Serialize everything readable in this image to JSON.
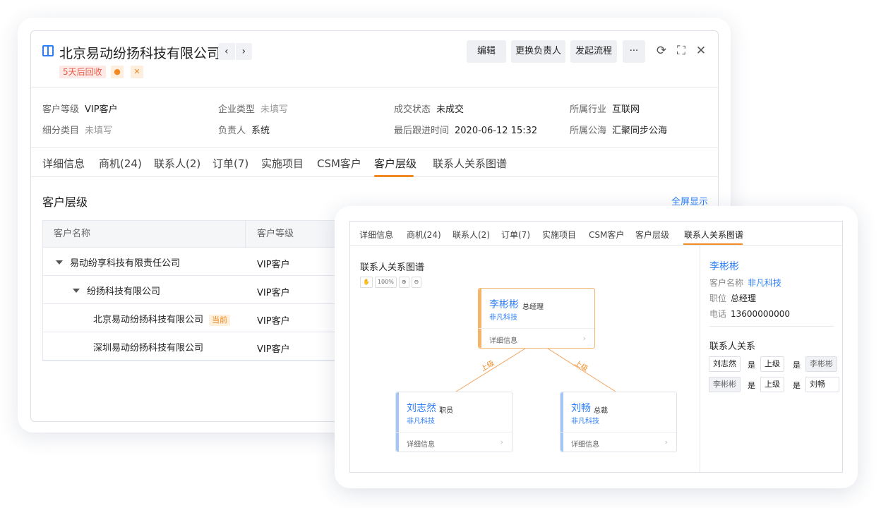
{
  "main": {
    "title": "北京易动纷扬科技有限公司",
    "prev_icon": "chevron-left-icon",
    "next_icon": "chevron-right-icon",
    "recycle_tag": "5天后回收",
    "actions": {
      "edit": "编辑",
      "change_owner": "更换负责人",
      "start_flow": "发起流程",
      "more": "···"
    },
    "info": [
      {
        "label": "客户等级",
        "value": "VIP客户"
      },
      {
        "label": "企业类型",
        "value": "未填写"
      },
      {
        "label": "成交状态",
        "value": "未成交"
      },
      {
        "label": "所属行业",
        "value": "互联网"
      },
      {
        "label": "细分类目",
        "value": "未填写"
      },
      {
        "label": "负责人",
        "value": "系统"
      },
      {
        "label": "最后跟进时间",
        "value": "2020-06-12 15:32"
      },
      {
        "label": "所属公海",
        "value": "汇聚同步公海"
      }
    ],
    "tabs": [
      "详细信息",
      "商机(24)",
      "联系人(2)",
      "订单(7)",
      "实施项目",
      "CSM客户",
      "客户层级",
      "联系人关系图谱"
    ],
    "section_title": "客户层级",
    "fullscreen_link": "全屏显示",
    "table": {
      "headers": [
        "客户名称",
        "客户等级"
      ],
      "rows": [
        {
          "name": "易动纷享科技有限责任公司",
          "level": "VIP客户"
        },
        {
          "name": "纷扬科技有限公司",
          "level": "VIP客户"
        },
        {
          "name": "北京易动纷扬科技有限公司",
          "level": "VIP客户",
          "tag": "当前"
        },
        {
          "name": "深圳易动纷扬科技有限公司",
          "level": "VIP客户"
        }
      ]
    }
  },
  "graph_panel": {
    "tabs": [
      "详细信息",
      "商机(24)",
      "联系人(2)",
      "订单(7)",
      "实施项目",
      "CSM客户",
      "客户层级",
      "联系人关系图谱"
    ],
    "title": "联系人关系图谱",
    "zoom": "100%",
    "edge_label": "上级",
    "nodes": {
      "root": {
        "name": "李彬彬",
        "role": "总经理",
        "company": "非凡科技",
        "detail": "详细信息"
      },
      "left": {
        "name": "刘志然",
        "role": "职员",
        "company": "非凡科技",
        "detail": "详细信息"
      },
      "right": {
        "name": "刘畅",
        "role": "总裁",
        "company": "非凡科技",
        "detail": "详细信息"
      }
    },
    "side": {
      "name": "李彬彬",
      "customer_label": "客户名称",
      "customer_value": "非凡科技",
      "position_label": "职位",
      "position_value": "总经理",
      "phone_label": "电话",
      "phone_value": "13600000000",
      "relations_title": "联系人关系",
      "is": "是",
      "relations": [
        {
          "a": "刘志然",
          "rel": "上级",
          "b": "李彬彬"
        },
        {
          "a": "李彬彬",
          "rel": "上级",
          "b": "刘畅"
        }
      ]
    }
  }
}
